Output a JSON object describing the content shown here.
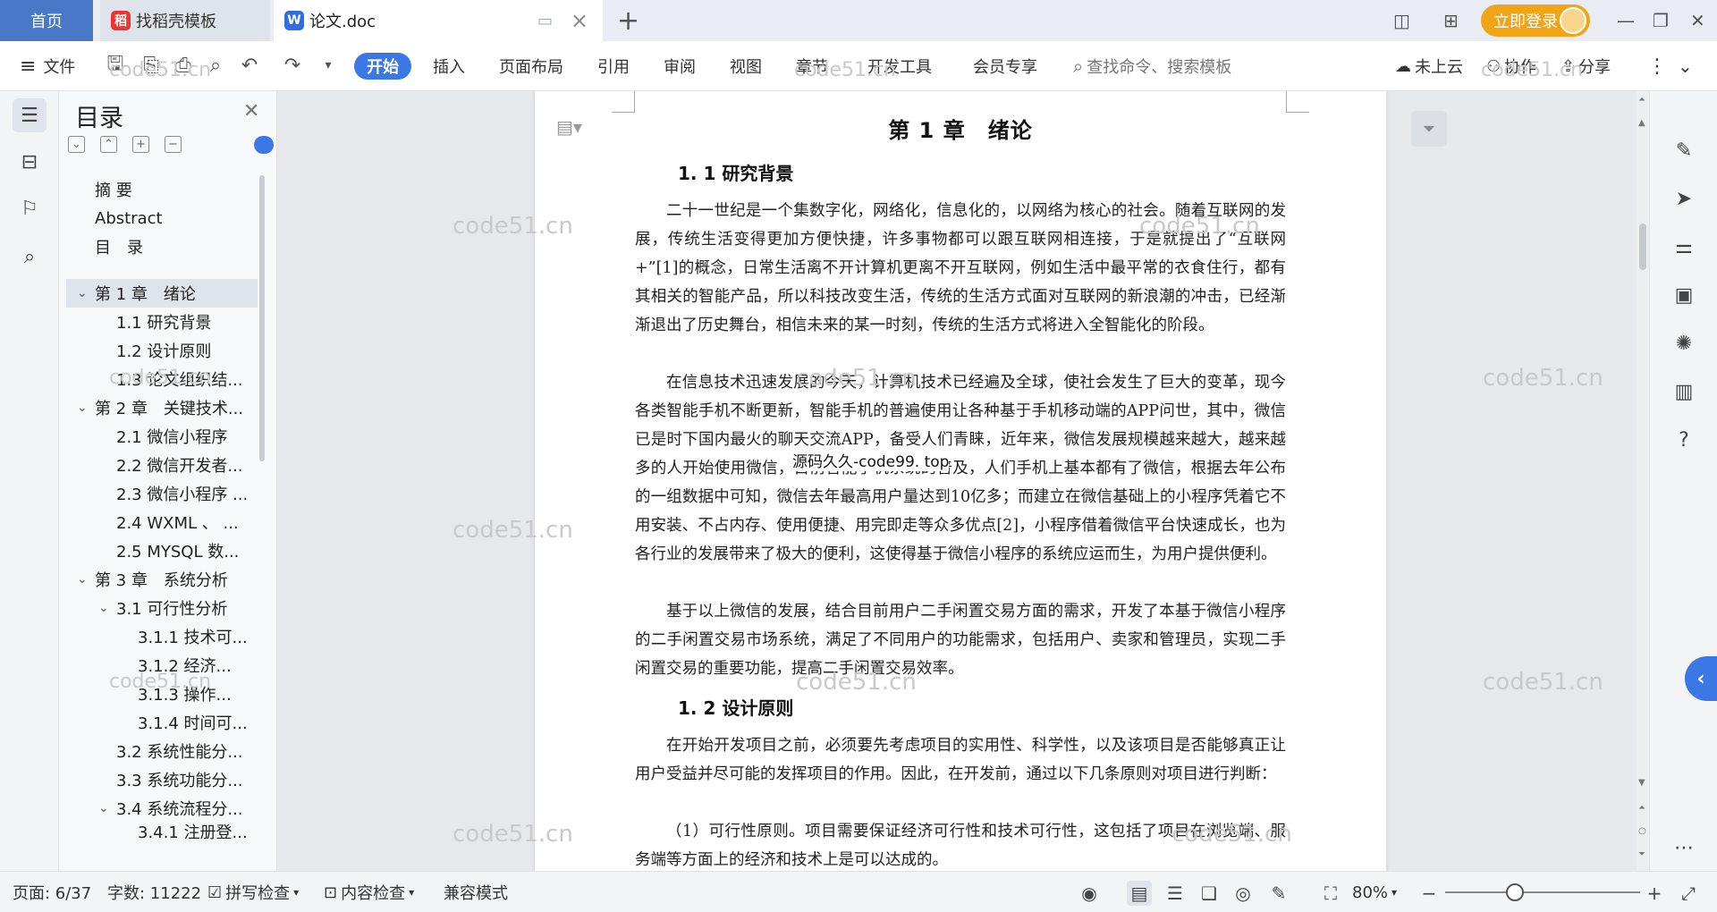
{
  "tabs": {
    "home": "首页",
    "wps_template": "找稻壳模板",
    "document": "论文.doc"
  },
  "titlebar": {
    "login": "立即登录"
  },
  "ribbon": {
    "file": "文件",
    "tabs": [
      "开始",
      "插入",
      "页面布局",
      "引用",
      "审阅",
      "视图",
      "章节",
      "开发工具",
      "会员专享"
    ],
    "search_placeholder": "查找命令、搜索模板",
    "cloud_status": "未上云",
    "collab": "协作",
    "share": "分享"
  },
  "toc": {
    "title": "目录",
    "items": [
      {
        "label": "摘 要"
      },
      {
        "label": "Abstract"
      },
      {
        "label": "目　录"
      },
      {
        "label": "第 1 章　绪论"
      },
      {
        "label": "1.1 研究背景"
      },
      {
        "label": "1.2 设计原则"
      },
      {
        "label": "1.3 论文组织结..."
      },
      {
        "label": "第 2 章　关键技术..."
      },
      {
        "label": "2.1  微信小程序"
      },
      {
        "label": "2.2  微信开发者..."
      },
      {
        "label": "2.3 微信小程序 ..."
      },
      {
        "label": "2.4 WXML  、 ..."
      },
      {
        "label": "2.5 MYSQL 数..."
      },
      {
        "label": "第 3 章　系统分析"
      },
      {
        "label": "3.1  可行性分析"
      },
      {
        "label": "3.1.1 技术可..."
      },
      {
        "label": "3.1.2  经济..."
      },
      {
        "label": "3.1.3  操作..."
      },
      {
        "label": "3.1.4 时间可..."
      },
      {
        "label": "3.2  系统性能分..."
      },
      {
        "label": "3.3  系统功能分..."
      },
      {
        "label": "3.4  系统流程分..."
      },
      {
        "label": "3.4.1 注册登..."
      }
    ]
  },
  "document": {
    "chapter_title": "第 1 章　绪论",
    "sec1_title": "1. 1 研究背景",
    "para1": "二十一世纪是一个集数字化，网络化，信息化的，以网络为核心的社会。随着互联网的发展，传统生活变得更加方便快捷，许多事物都可以跟互联网相连接，于是就提出了“互联网+”[1]的概念，日常生活离不开计算机更离不开互联网，例如生活中最平常的衣食住行，都有其相关的智能产品，所以科技改变生活，传统的生活方式面对互联网的新浪潮的冲击，已经渐渐退出了历史舞台，相信未来的某一时刻，传统的生活方式将进入全智能化的阶段。",
    "para2": "在信息技术迅速发展的今天，计算机技术已经遍及全球，使社会发生了巨大的变革，现今各类智能手机不断更新，智能手机的普遍使用让各种基于手机移动端的APP问世，其中，微信已是时下国内最火的聊天交流APP，备受人们青睐，近年来，微信发展规模越来越大，越来越多的人开始使用微信，目前智能手机系统的普及，人们手机上基本都有了微信，根据去年公布的一组数据中可知，微信去年最高用户量达到10亿多；而建立在微信基础上的小程序凭着它不用安装、不占内存、使用便捷、用完即走等众多优点[2]，小程序借着微信平台快速成长，也为各行业的发展带来了极大的便利，这使得基于微信小程序的系统应运而生，为用户提供便利。",
    "para3": "基于以上微信的发展，结合目前用户二手闲置交易方面的需求，开发了本基于微信小程序的二手闲置交易市场系统，满足了不同用户的功能需求，包括用户、卖家和管理员，实现二手闲置交易的重要功能，提高二手闲置交易效率。",
    "sec2_title": "1. 2 设计原则",
    "para4": "在开始开发项目之前，必须要先考虑项目的实用性、科学性，以及该项目是否能够真正让用户受益并尽可能的发挥项目的作用。因此，在开发前，通过以下几条原则对项目进行判断：",
    "para5": "（1）可行性原则。项目需要保证经济可行性和技术可行性，这包括了项目在浏览端、服务端等方面上的经济和技术上是可以达成的。",
    "overlay_text": "源码久久-code99. top"
  },
  "watermark": "code51.cn",
  "status": {
    "page": "页面: 6/37",
    "words": "字数: 11222",
    "spell": "拼写检查",
    "content_check": "内容检查",
    "compat": "兼容模式",
    "zoom": "80%"
  },
  "colors": {
    "accent": "#3b78e6",
    "login": "#f0a416",
    "home_tab": "#4a78c9"
  }
}
